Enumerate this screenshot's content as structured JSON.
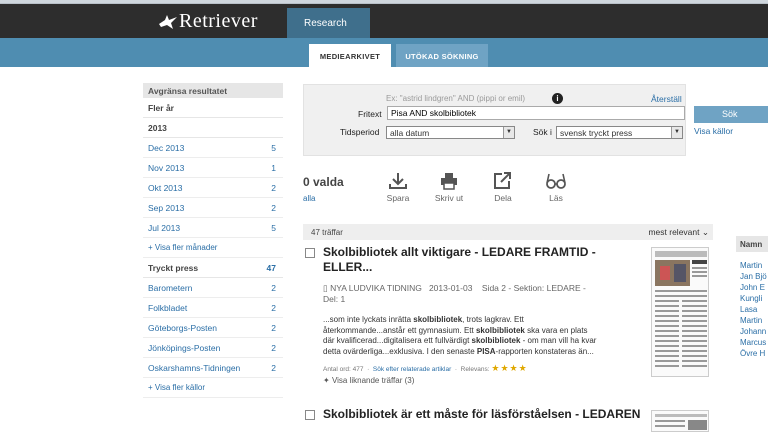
{
  "header": {
    "logo_text": "Retriever",
    "nav_tab": "Research"
  },
  "tabs": [
    {
      "label": "MEDIEARKIVET",
      "active": true
    },
    {
      "label": "UTÖKAD SÖKNING",
      "active": false
    }
  ],
  "sidebar": {
    "title": "Avgränsa resultatet",
    "year_section": "Fler år",
    "year_value": "2013",
    "months": [
      {
        "label": "Dec 2013",
        "count": "5"
      },
      {
        "label": "Nov 2013",
        "count": "1"
      },
      {
        "label": "Okt 2013",
        "count": "2"
      },
      {
        "label": "Sep 2013",
        "count": "2"
      },
      {
        "label": "Jul 2013",
        "count": "5"
      }
    ],
    "more_months": "+ Visa fler månader",
    "source_section": "Tryckt press",
    "source_count": "47",
    "sources": [
      {
        "label": "Barometern",
        "count": "2"
      },
      {
        "label": "Folkbladet",
        "count": "2"
      },
      {
        "label": "Göteborgs-Posten",
        "count": "2"
      },
      {
        "label": "Jönköpings-Posten",
        "count": "2"
      },
      {
        "label": "Oskarshamns-Tidningen",
        "count": "2"
      }
    ],
    "more_sources": "+ Visa fler källor"
  },
  "search": {
    "hint": "Ex: \"astrid lindgren\" AND (pippi or emil)",
    "reset_link": "Återställ",
    "fritext_label": "Fritext",
    "fritext_value": "Pisa AND skolbibliotek",
    "period_label": "Tidsperiod",
    "period_value": "alla datum",
    "sok_i_label": "Sök i",
    "sok_i_value": "svensk tryckt press",
    "search_button": "Sök",
    "show_sources": "Visa källor"
  },
  "toolbar": {
    "selected": "0 valda",
    "all_link": "alla",
    "actions": [
      {
        "label": "Spara",
        "icon": "download-icon"
      },
      {
        "label": "Skriv ut",
        "icon": "printer-icon"
      },
      {
        "label": "Dela",
        "icon": "share-icon"
      },
      {
        "label": "Läs",
        "icon": "glasses-icon"
      }
    ]
  },
  "results": {
    "count": "47 träffar",
    "sort": "mest relevant",
    "items": [
      {
        "title": "Skolbibliotek allt viktigare - LEDARE FRAMTID - ELLER...",
        "source": "NYA LUDVIKA TIDNING",
        "date": "2013-01-03",
        "page": "Sida 2",
        "section": "Sektion: LEDARE",
        "part": "Del: 1",
        "snippet_l1": "...som inte lyckats inrätta skolbibliotek, trots lagkrav. Ett",
        "snippet_l2": "återkommande...anstår ett gymnasium. Ett skolbibliotek ska vara en plats",
        "snippet_l3": "där kvalificerad...digitalisera ett fullvärdigt skolbibliotek - om man vill ha kvar",
        "snippet_l4": "detta ovärderliga...exklusiva. I den senaste PISA-rapporten konstateras än...",
        "word_count": "Antal ord: 477",
        "related": "Sök efter relaterade artiklar",
        "relevance": "Relevans:",
        "relevance_stars": 4,
        "similar": "Visa liknande träffar (3)"
      },
      {
        "title": "Skolbibliotek är ett måste för läsförståelsen - LEDAREN"
      }
    ]
  },
  "right_list": {
    "header": "Namn",
    "items": [
      "Martin",
      "Jan Bjö",
      "John E",
      "Kungli",
      "Lasa",
      "Martin",
      "Johann",
      "Marcus",
      "Övre H"
    ]
  }
}
